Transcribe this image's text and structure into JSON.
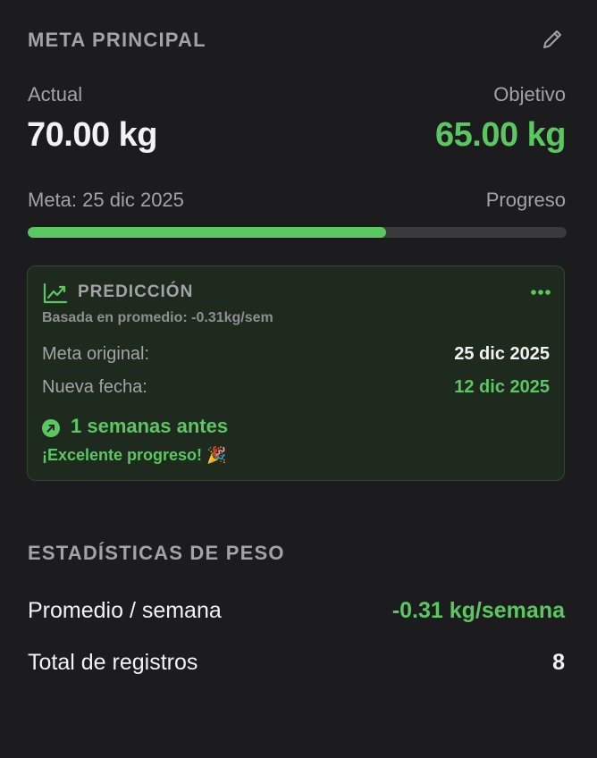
{
  "goal": {
    "header": "META PRINCIPAL",
    "edit_icon": "pencil-icon",
    "current_label": "Actual",
    "current_value": "70.00 kg",
    "target_label": "Objetivo",
    "target_value": "65.00 kg",
    "deadline": "Meta: 25 dic 2025",
    "progress_label": "Progreso",
    "progress_fraction": 0.665
  },
  "prediction": {
    "title": "PREDICCIÓN",
    "icon": "trend-up-icon",
    "more_icon": "ellipsis-icon",
    "subtitle": "Basada en promedio: -0.31kg/sem",
    "original_label": "Meta original:",
    "original_value": "25 dic 2025",
    "new_label": "Nueva fecha:",
    "new_value": "12 dic 2025",
    "early_icon": "arrow-up-right-circle-icon",
    "early_text": "1 semanas antes",
    "excellent_text": "¡Excelente progreso! 🎉"
  },
  "stats": {
    "header": "ESTADÍSTICAS DE PESO",
    "avg_label": "Promedio / semana",
    "avg_value": "-0.31 kg/semana",
    "total_label": "Total de registros",
    "total_value": "8"
  },
  "colors": {
    "background": "#1c1c1e",
    "accent_green": "#5ac761",
    "muted_text": "#a3a3a7",
    "primary_text": "#f2f2f2",
    "track": "#3a3a3c",
    "card_bg": "#1f2a1f",
    "card_border": "#2f4a30"
  }
}
